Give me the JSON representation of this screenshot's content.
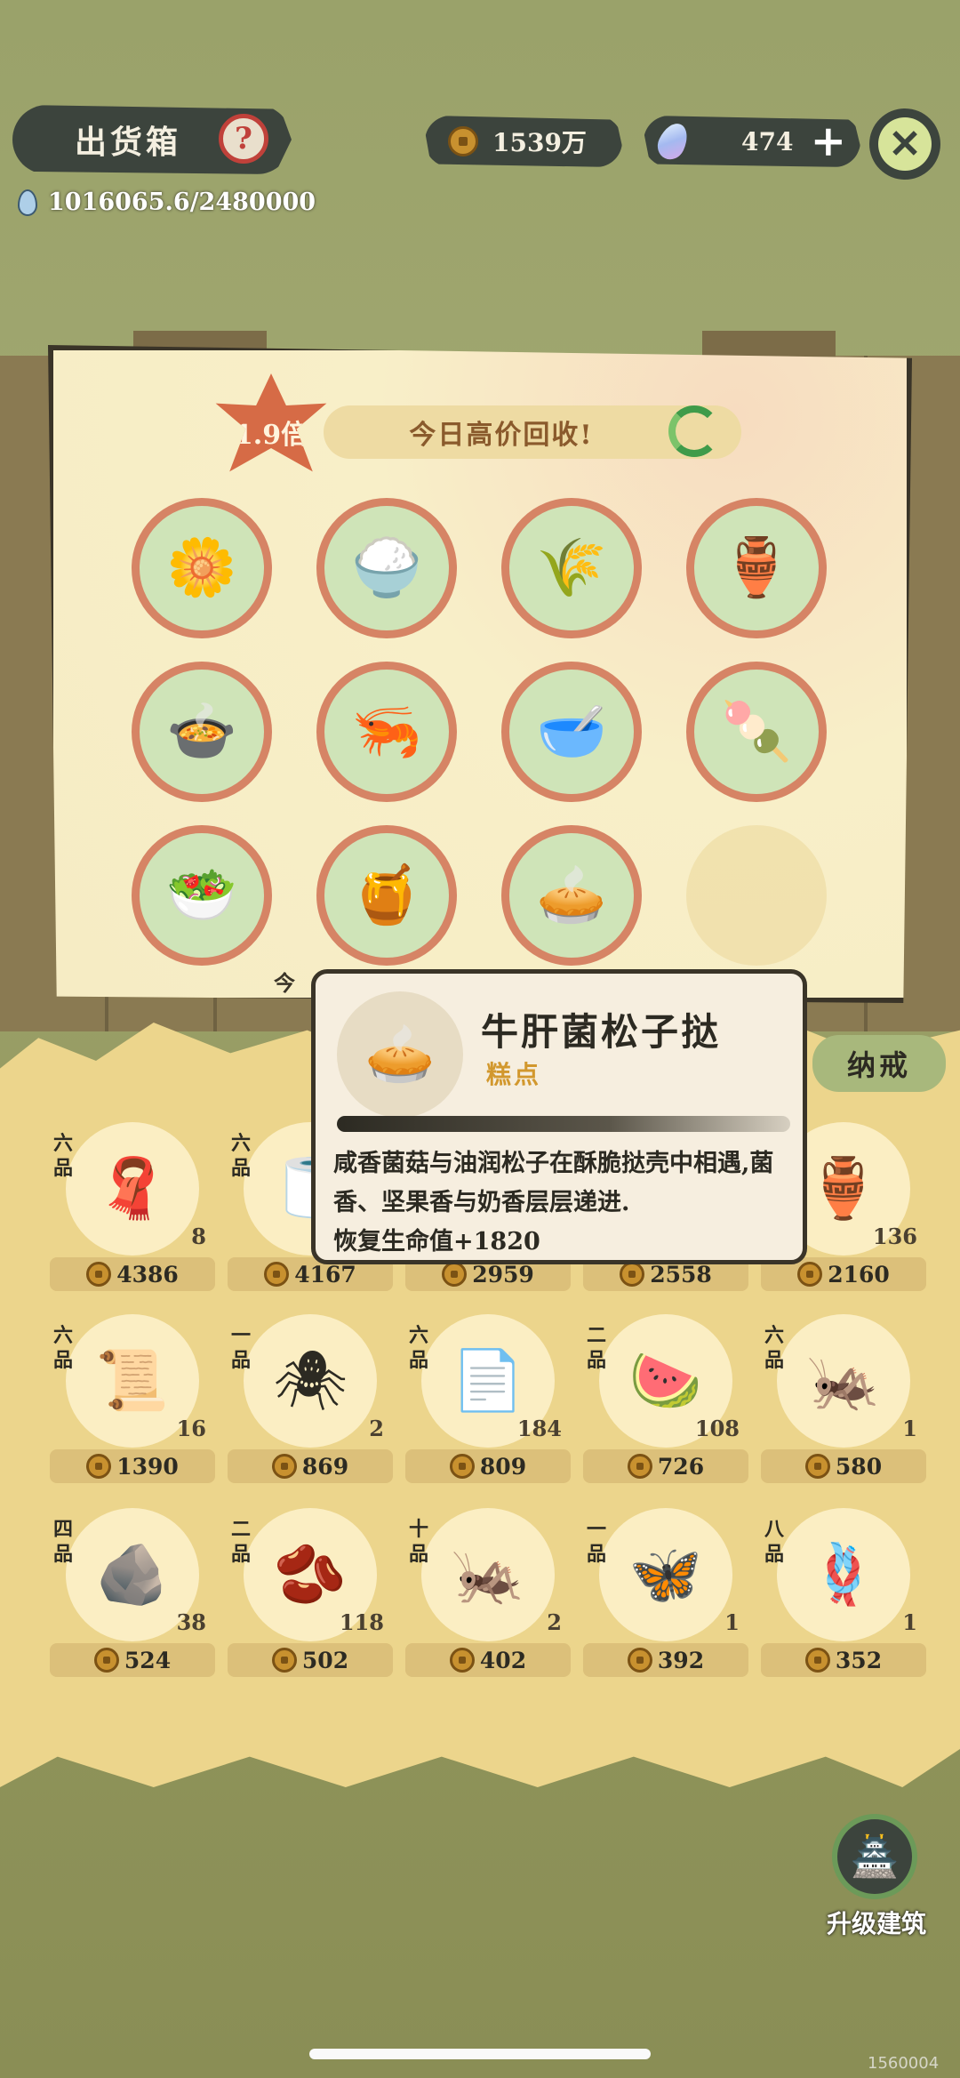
{
  "header": {
    "title": "出货箱",
    "help_icon": "?",
    "coins": "1539万",
    "gems": "474",
    "gem_plus": "+",
    "close_glyph": "✕",
    "water": "1016065.6/2480000"
  },
  "poster": {
    "multiplier": "1.9倍",
    "banner": "今日高价回收!",
    "items": [
      {
        "name": "chrysanthemum",
        "glyph": "🌼"
      },
      {
        "name": "rice-grains",
        "glyph": "🍚"
      },
      {
        "name": "white-seeds",
        "glyph": "🌾"
      },
      {
        "name": "clay-jar",
        "glyph": "🏺"
      },
      {
        "name": "braised-dish",
        "glyph": "🍲"
      },
      {
        "name": "shrimp-leaf",
        "glyph": "🦐"
      },
      {
        "name": "soup-bowl",
        "glyph": "🥣"
      },
      {
        "name": "meatball-plate",
        "glyph": "🍡"
      },
      {
        "name": "stir-fry-plate",
        "glyph": "🥗"
      },
      {
        "name": "clay-pot-soup",
        "glyph": "🍯"
      },
      {
        "name": "mushroom-tarts",
        "glyph": "🥧"
      },
      {
        "name": "empty",
        "glyph": ""
      }
    ],
    "footer_fragment": "今"
  },
  "storage": {
    "tab": "纳戒",
    "slots": [
      {
        "grade": "六品",
        "glyph": "🧣",
        "qty": "8",
        "price": "4386"
      },
      {
        "grade": "六品",
        "glyph": "🧻",
        "qty": "",
        "price": "4167"
      },
      {
        "grade": "",
        "glyph": "",
        "qty": "",
        "price": "2959"
      },
      {
        "grade": "",
        "glyph": "",
        "qty": "",
        "price": "2558"
      },
      {
        "grade": "",
        "glyph": "🏺",
        "qty": "136",
        "price": "2160"
      },
      {
        "grade": "六品",
        "glyph": "📜",
        "qty": "16",
        "price": "1390"
      },
      {
        "grade": "一品",
        "glyph": "🕷",
        "qty": "2",
        "price": "869"
      },
      {
        "grade": "六品",
        "glyph": "📄",
        "qty": "184",
        "price": "809"
      },
      {
        "grade": "二品",
        "glyph": "🍉",
        "qty": "108",
        "price": "726"
      },
      {
        "grade": "六品",
        "glyph": "🦗",
        "qty": "1",
        "price": "580"
      },
      {
        "grade": "四品",
        "glyph": "🪨",
        "qty": "38",
        "price": "524"
      },
      {
        "grade": "二品",
        "glyph": "🫘",
        "qty": "118",
        "price": "502"
      },
      {
        "grade": "十品",
        "glyph": "🦗",
        "qty": "2",
        "price": "402"
      },
      {
        "grade": "一品",
        "glyph": "🦋",
        "qty": "1",
        "price": "392"
      },
      {
        "grade": "八品",
        "glyph": "🪢",
        "qty": "1",
        "price": "352"
      }
    ]
  },
  "tooltip": {
    "glyph": "🥧",
    "name": "牛肝菌松子挞",
    "category": "糕点",
    "description": "咸香菌菇与油润松子在酥脆挞壳中相遇,菌香、坚果香与奶香层层递进.",
    "effect": "恢复生命值+1820"
  },
  "upgrade": {
    "glyph": "🏯",
    "label": "升级建筑"
  },
  "build_id": "1560004"
}
